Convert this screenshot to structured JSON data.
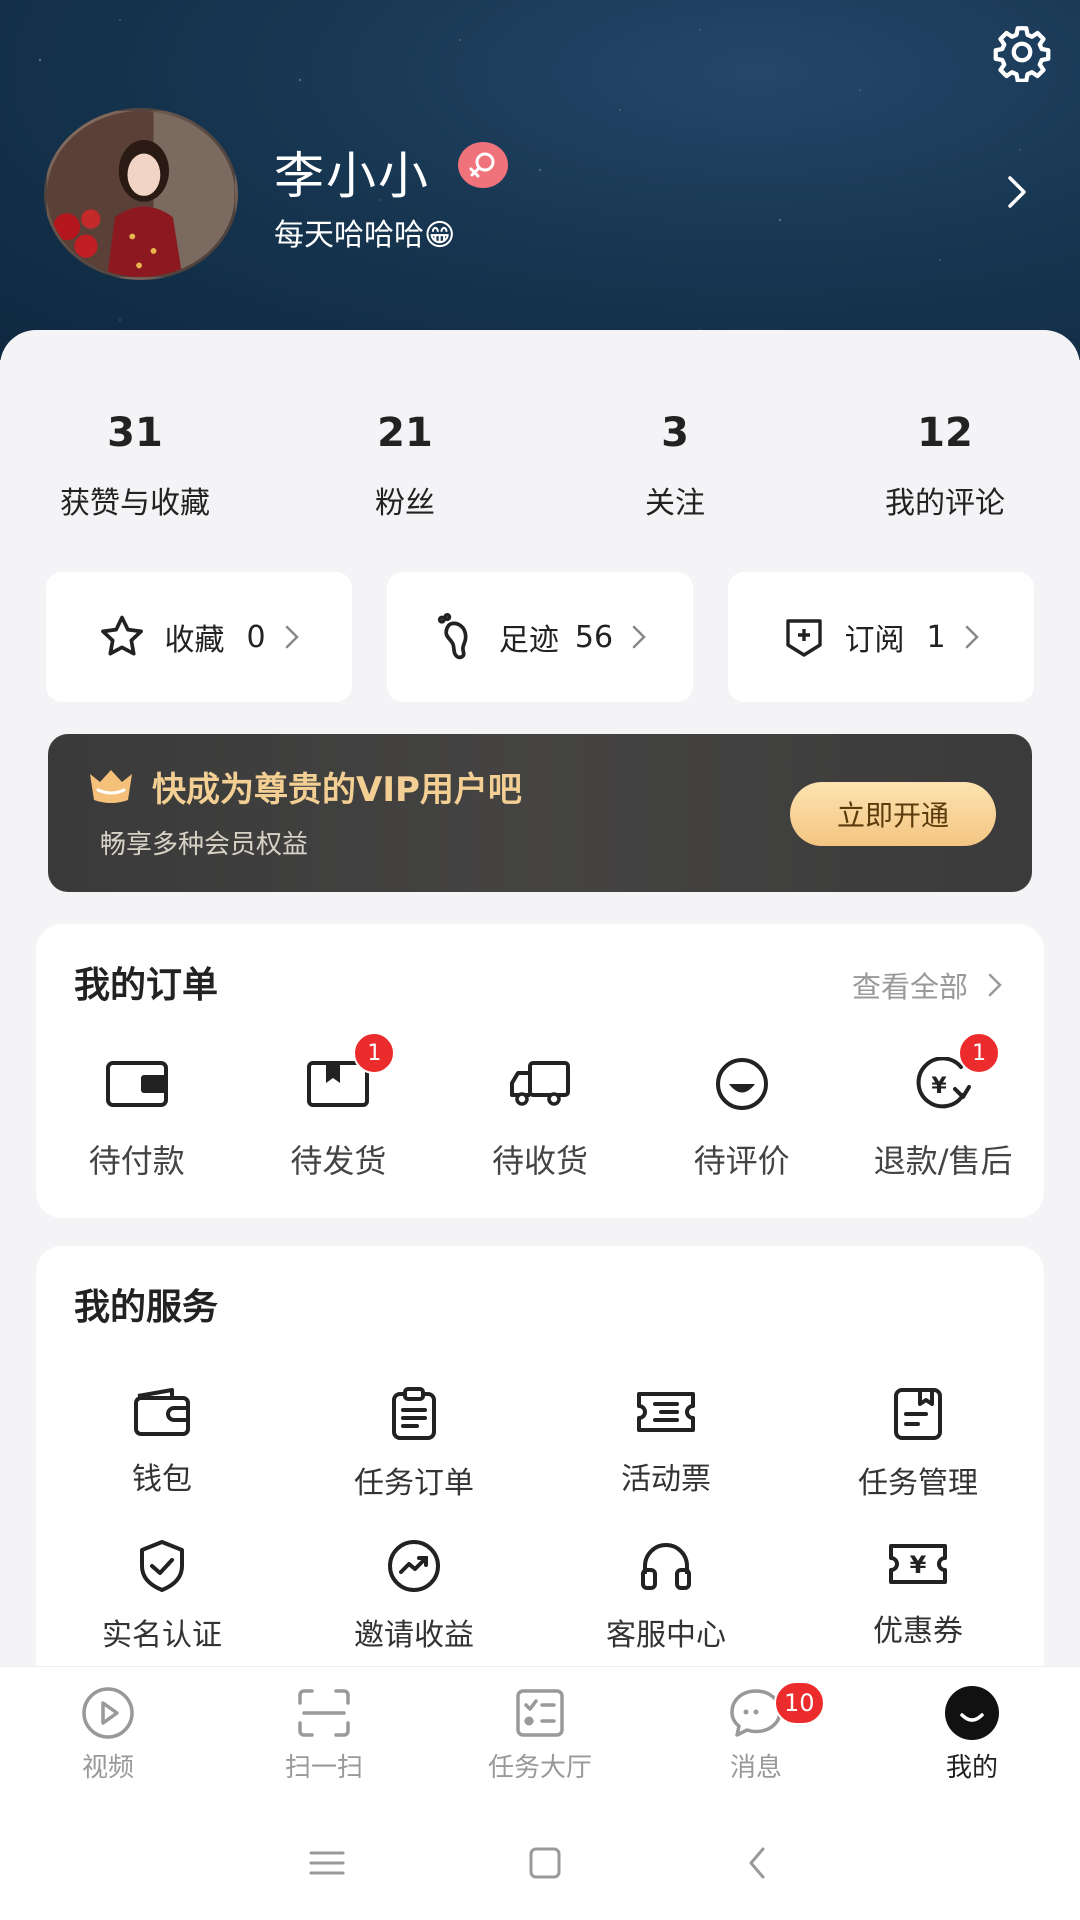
{
  "profile": {
    "name": "李小小",
    "motto": "每天哈哈哈😁",
    "gender_icon": "female-icon",
    "settings_icon": "gear-icon"
  },
  "stats": [
    {
      "value": "31",
      "label": "获赞与收藏"
    },
    {
      "value": "21",
      "label": "粉丝"
    },
    {
      "value": "3",
      "label": "关注"
    },
    {
      "value": "12",
      "label": "我的评论"
    }
  ],
  "quick": [
    {
      "label": "收藏",
      "count": "0",
      "icon": "star-icon"
    },
    {
      "label": "足迹",
      "count": "56",
      "icon": "footprint-icon"
    },
    {
      "label": "订阅",
      "count": "1",
      "icon": "subscribe-icon"
    }
  ],
  "vip": {
    "title": "快成为尊贵的VIP用户吧",
    "subtitle": "畅享多种会员权益",
    "button": "立即开通",
    "accent": "#f3cf93"
  },
  "orders": {
    "title": "我的订单",
    "see_all": "查看全部",
    "items": [
      {
        "label": "待付款",
        "icon": "wallet-icon",
        "badge": ""
      },
      {
        "label": "待发货",
        "icon": "package-icon",
        "badge": "1"
      },
      {
        "label": "待收货",
        "icon": "truck-icon",
        "badge": ""
      },
      {
        "label": "待评价",
        "icon": "review-icon",
        "badge": ""
      },
      {
        "label": "退款/售后",
        "icon": "refund-icon",
        "badge": "1"
      }
    ]
  },
  "services": {
    "title": "我的服务",
    "items": [
      {
        "label": "钱包",
        "icon": "wallet-icon"
      },
      {
        "label": "任务订单",
        "icon": "clipboard-icon"
      },
      {
        "label": "活动票",
        "icon": "ticket-icon"
      },
      {
        "label": "任务管理",
        "icon": "task-manage-icon"
      },
      {
        "label": "实名认证",
        "icon": "shield-check-icon"
      },
      {
        "label": "邀请收益",
        "icon": "trend-icon"
      },
      {
        "label": "客服中心",
        "icon": "headset-icon"
      },
      {
        "label": "优惠券",
        "icon": "coupon-icon"
      }
    ]
  },
  "tabs": [
    {
      "label": "视频",
      "icon": "play-icon",
      "badge": ""
    },
    {
      "label": "扫一扫",
      "icon": "scan-icon",
      "badge": ""
    },
    {
      "label": "任务大厅",
      "icon": "task-hall-icon",
      "badge": ""
    },
    {
      "label": "消息",
      "icon": "message-icon",
      "badge": "10"
    },
    {
      "label": "我的",
      "icon": "profile-icon",
      "badge": "",
      "active": true
    }
  ],
  "system_nav": [
    "menu-icon",
    "home-icon",
    "back-icon"
  ]
}
